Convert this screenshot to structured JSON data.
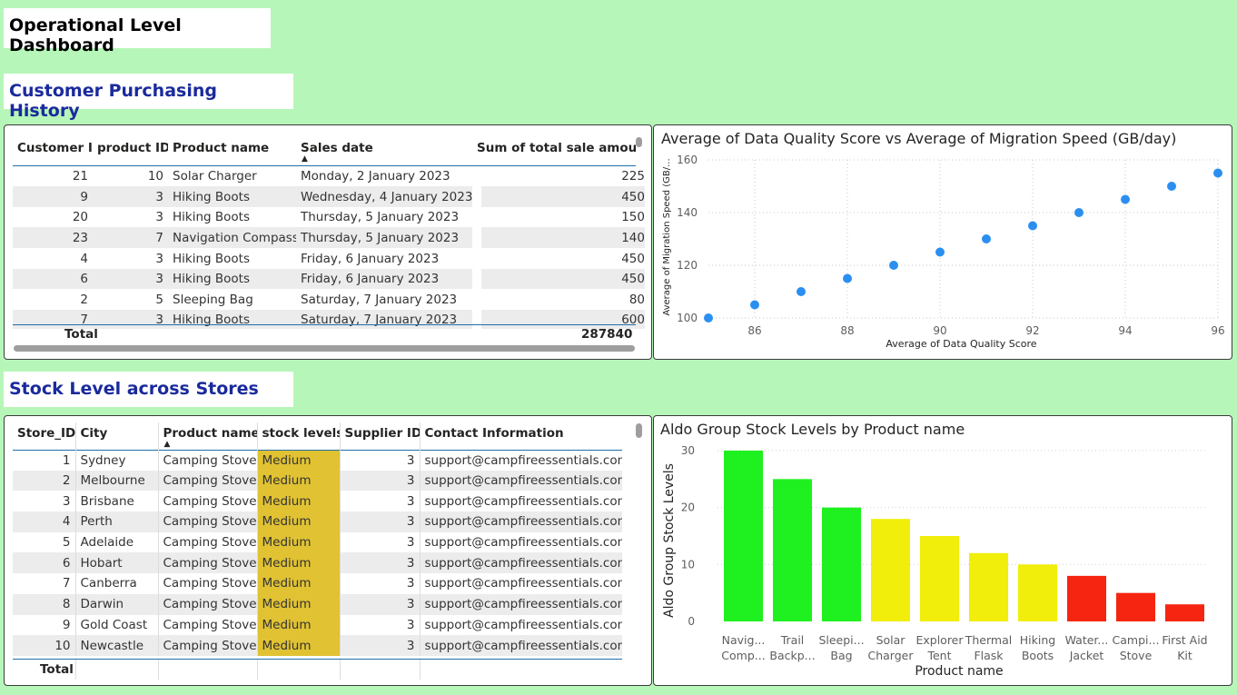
{
  "page_title": "Operational Level Dashboard",
  "section1_title": "Customer Purchasing History",
  "section2_title": "Stock Level across Stores",
  "purchase_table": {
    "headers": [
      "Customer ID",
      "product ID",
      "Product name",
      "Sales date",
      "Sum of total sale amount"
    ],
    "rows": [
      [
        "21",
        "10",
        "Solar Charger",
        "Monday, 2 January 2023",
        "225"
      ],
      [
        "9",
        "3",
        "Hiking Boots",
        "Wednesday, 4 January 2023",
        "450"
      ],
      [
        "20",
        "3",
        "Hiking Boots",
        "Thursday, 5 January 2023",
        "150"
      ],
      [
        "23",
        "7",
        "Navigation Compass",
        "Thursday, 5 January 2023",
        "140"
      ],
      [
        "4",
        "3",
        "Hiking Boots",
        "Friday, 6 January 2023",
        "450"
      ],
      [
        "6",
        "3",
        "Hiking Boots",
        "Friday, 6 January 2023",
        "450"
      ],
      [
        "2",
        "5",
        "Sleeping Bag",
        "Saturday, 7 January 2023",
        "80"
      ],
      [
        "7",
        "3",
        "Hiking Boots",
        "Saturday, 7 January 2023",
        "600"
      ]
    ],
    "total_label": "Total",
    "total_value": "287840"
  },
  "stock_table": {
    "headers": [
      "Store_ID",
      "City",
      "Product name",
      "stock levels",
      "Supplier ID",
      "Contact Information"
    ],
    "rows": [
      [
        "1",
        "Sydney",
        "Camping Stove",
        "Medium",
        "3",
        "support@campfireessentials.com"
      ],
      [
        "2",
        "Melbourne",
        "Camping Stove",
        "Medium",
        "3",
        "support@campfireessentials.com"
      ],
      [
        "3",
        "Brisbane",
        "Camping Stove",
        "Medium",
        "3",
        "support@campfireessentials.com"
      ],
      [
        "4",
        "Perth",
        "Camping Stove",
        "Medium",
        "3",
        "support@campfireessentials.com"
      ],
      [
        "5",
        "Adelaide",
        "Camping Stove",
        "Medium",
        "3",
        "support@campfireessentials.com"
      ],
      [
        "6",
        "Hobart",
        "Camping Stove",
        "Medium",
        "3",
        "support@campfireessentials.com"
      ],
      [
        "7",
        "Canberra",
        "Camping Stove",
        "Medium",
        "3",
        "support@campfireessentials.com"
      ],
      [
        "8",
        "Darwin",
        "Camping Stove",
        "Medium",
        "3",
        "support@campfireessentials.com"
      ],
      [
        "9",
        "Gold Coast",
        "Camping Stove",
        "Medium",
        "3",
        "support@campfireessentials.com"
      ],
      [
        "10",
        "Newcastle",
        "Camping Stove",
        "Medium",
        "3",
        "support@campfireessentials.com"
      ]
    ],
    "total_label": "Total",
    "stock_color": "#e0c233"
  },
  "chart_data": [
    {
      "type": "scatter",
      "title": "Average of Data Quality Score vs Average of Migration Speed (GB/day)",
      "xlabel": "Average of Data Quality Score",
      "ylabel": "Average of Migration Speed (GB/...",
      "xlim": [
        85,
        96
      ],
      "ylim": [
        100,
        160
      ],
      "xticks": [
        86,
        88,
        90,
        92,
        94,
        96
      ],
      "yticks": [
        100,
        120,
        140,
        160
      ],
      "grid": true,
      "color": "#2b8ff0",
      "points": [
        {
          "x": 85,
          "y": 100
        },
        {
          "x": 86,
          "y": 105
        },
        {
          "x": 87,
          "y": 110
        },
        {
          "x": 88,
          "y": 115
        },
        {
          "x": 89,
          "y": 120
        },
        {
          "x": 90,
          "y": 125
        },
        {
          "x": 91,
          "y": 130
        },
        {
          "x": 92,
          "y": 135
        },
        {
          "x": 93,
          "y": 140
        },
        {
          "x": 94,
          "y": 145
        },
        {
          "x": 95,
          "y": 150
        },
        {
          "x": 96,
          "y": 155
        }
      ]
    },
    {
      "type": "bar",
      "title": "Aldo Group Stock Levels by Product name",
      "xlabel": "Product name",
      "ylabel": "Aldo Group Stock Levels",
      "ylim": [
        0,
        30
      ],
      "yticks": [
        0,
        10,
        20,
        30
      ],
      "grid": true,
      "categories": [
        [
          "Navig...",
          "Comp..."
        ],
        [
          "Trail",
          "Backp..."
        ],
        [
          "Sleepi...",
          "Bag"
        ],
        [
          "Solar",
          "Charger"
        ],
        [
          "Explorer",
          "Tent"
        ],
        [
          "Thermal",
          "Flask"
        ],
        [
          "Hiking",
          "Boots"
        ],
        [
          "Water...",
          "Jacket"
        ],
        [
          "Campi...",
          "Stove"
        ],
        [
          "First Aid",
          "Kit"
        ]
      ],
      "values": [
        30,
        25,
        20,
        18,
        15,
        12,
        10,
        8,
        5,
        3
      ],
      "colors": [
        "#1ff01f",
        "#1ff01f",
        "#1ff01f",
        "#f0ee0a",
        "#f0ee0a",
        "#f0ee0a",
        "#f0ee0a",
        "#f52511",
        "#f52511",
        "#f52511"
      ]
    }
  ]
}
